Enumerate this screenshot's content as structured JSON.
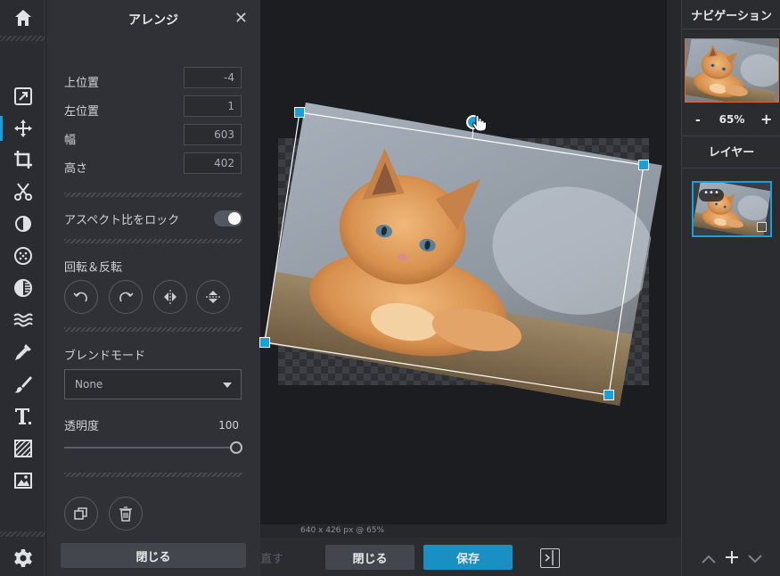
{
  "toolbar": {
    "tools": [
      "home-icon",
      "resize-icon",
      "move-icon",
      "crop-icon",
      "cut-icon",
      "adjust-icon",
      "effects-icon",
      "filter-icon",
      "wave-icon",
      "eyedropper-icon",
      "brush-icon",
      "text-icon",
      "texture-icon",
      "image-icon",
      "settings-icon"
    ],
    "active_tool": "move-icon",
    "accent": "#1aa0d8"
  },
  "arrange_panel": {
    "title": "アレンジ",
    "close_symbol": "✕",
    "top_label": "上位置",
    "top_value": "-4",
    "left_label": "左位置",
    "left_value": "1",
    "width_label": "幅",
    "width_value": "603",
    "height_label": "高さ",
    "height_value": "402",
    "aspect_lock_label": "アスペクト比をロック",
    "aspect_lock_on": true,
    "rotate_flip_label": "回転＆反転",
    "blend_mode_label": "ブレンドモード",
    "blend_mode_value": "None",
    "opacity_label": "透明度",
    "opacity_value": "100",
    "close_button": "閉じる"
  },
  "canvas": {
    "image_info": "640 x 426 px @ 65%"
  },
  "bottom_bar": {
    "undo_text": "直す",
    "close_button": "閉じる",
    "save_button": "保存",
    "save_color": "#1a8fc3"
  },
  "right_panel": {
    "navigation_title": "ナビゲーション",
    "zoom_minus": "-",
    "zoom_value": "65%",
    "zoom_plus": "+",
    "layers_title": "レイヤー",
    "layer_menu": "•••",
    "layer_controls": [
      "chevron-up-icon",
      "plus-icon",
      "chevron-down-icon"
    ],
    "nav_border_color": "#e0662f"
  }
}
